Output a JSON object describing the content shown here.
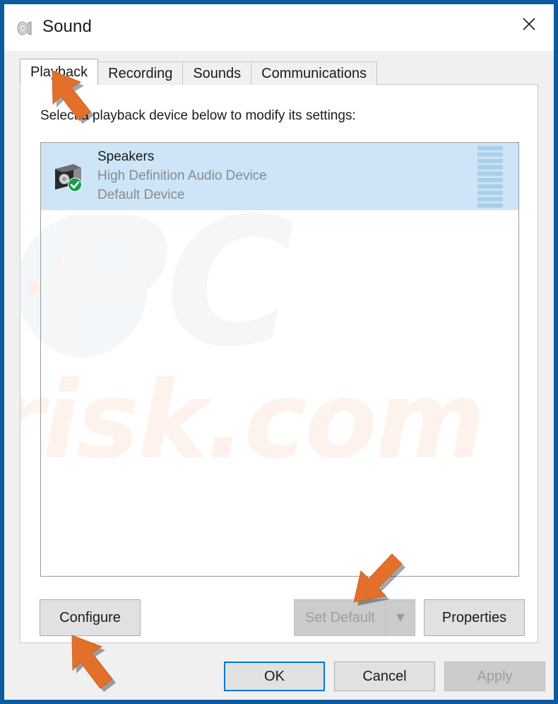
{
  "window": {
    "title": "Sound",
    "icon": "speaker-icon",
    "close_label": "✕",
    "border_color": "#0b5ba1"
  },
  "tabs": [
    {
      "label": "Playback",
      "active": true
    },
    {
      "label": "Recording",
      "active": false
    },
    {
      "label": "Sounds",
      "active": false
    },
    {
      "label": "Communications",
      "active": false
    }
  ],
  "panel": {
    "instruction": "Select a playback device below to modify its settings:"
  },
  "devices": [
    {
      "name": "Speakers",
      "driver": "High Definition Audio Device",
      "status": "Default Device",
      "selected": true,
      "badge": "default-check-icon",
      "meter_segments": 10
    }
  ],
  "mid_buttons": {
    "configure": "Configure",
    "set_default": "Set Default",
    "set_default_dropdown": "▼",
    "set_default_disabled": true,
    "properties": "Properties"
  },
  "footer_buttons": {
    "ok": "OK",
    "cancel": "Cancel",
    "apply": "Apply",
    "apply_disabled": true,
    "ok_focused": true
  },
  "watermark": {
    "primary": "PC",
    "secondary": "risk.com"
  },
  "annotations": [
    {
      "name": "arrow-playback-tab",
      "points_to": "Playback tab",
      "direction": "up-left"
    },
    {
      "name": "arrow-set-default",
      "points_to": "Set Default button",
      "direction": "down-left"
    },
    {
      "name": "arrow-configure",
      "points_to": "Configure button",
      "direction": "up-left"
    }
  ],
  "colors": {
    "accent": "#0078d7",
    "window_border": "#0b5ba1",
    "selection": "#cde5f7",
    "annotation": "#e2702a"
  }
}
